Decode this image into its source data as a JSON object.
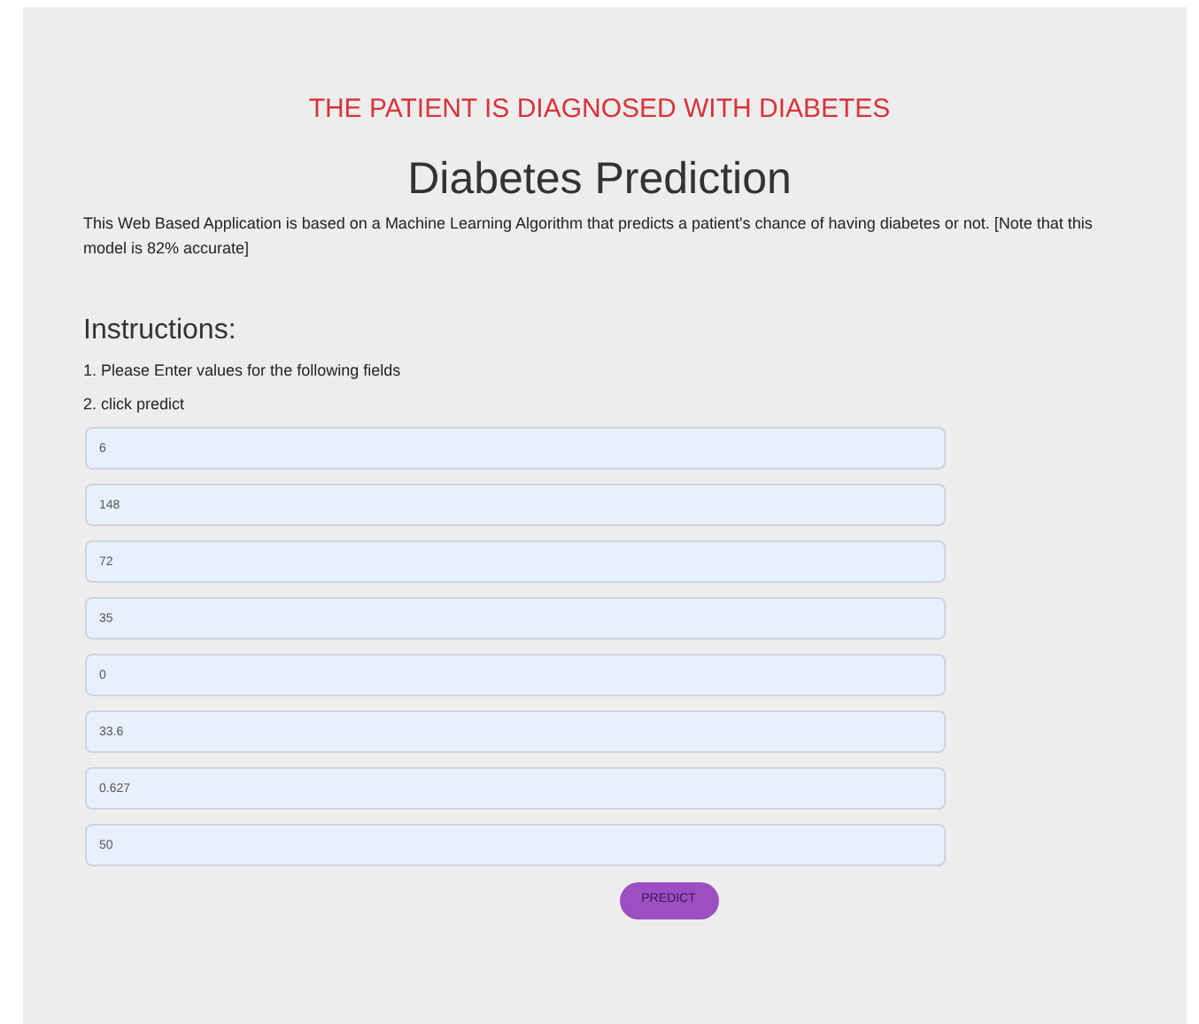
{
  "result": "THE PATIENT IS DIAGNOSED WITH DIABETES",
  "title": "Diabetes Prediction",
  "description": "This Web Based Application is based on a Machine Learning Algorithm that predicts a patient's chance of having diabetes or not. [Note that this model is 82% accurate]",
  "instructions": {
    "heading": "Instructions:",
    "steps": [
      "1. Please Enter values for the following fields",
      "2. click predict"
    ]
  },
  "fields": [
    {
      "value": "6"
    },
    {
      "value": "148"
    },
    {
      "value": "72"
    },
    {
      "value": "35"
    },
    {
      "value": "0"
    },
    {
      "value": "33.6"
    },
    {
      "value": "0.627"
    },
    {
      "value": "50"
    }
  ],
  "button": "PREDICT"
}
